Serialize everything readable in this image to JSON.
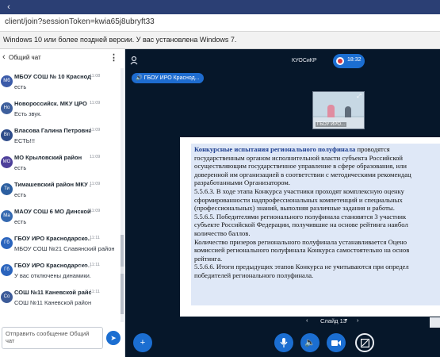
{
  "browser": {
    "url": "client/join?sessionToken=kwia65j8ubryft33",
    "info_message": "Windows 10 или более поздней версии. У вас установлена Windows 7."
  },
  "chat": {
    "title": "Общий чат",
    "messages": [
      {
        "initials": "Мб",
        "color": "#3b5ba9",
        "sender": "МБОУ СОШ № 10 Краснода...",
        "time": "11:08",
        "text": "есть"
      },
      {
        "initials": "Но",
        "color": "#3e5f9c",
        "sender": "Новороссийск. МКУ ЦРО",
        "time": "11:09",
        "text": "Есть звук."
      },
      {
        "initials": "Вп",
        "color": "#2f4d8a",
        "sender": "Власова Галина Петровна",
        "time": "11:09",
        "text": "ЕСТЬ!!!"
      },
      {
        "initials": "МО",
        "color": "#4d3f9a",
        "sender": "МО Крыловский район",
        "time": "11:09",
        "text": "есть"
      },
      {
        "initials": "Ти",
        "color": "#2c5fa0",
        "sender": "Тимашевский район МКУ ...",
        "time": "11:09",
        "text": "есть"
      },
      {
        "initials": "Ма",
        "color": "#3569b0",
        "sender": "МАОУ СОШ 6 МО Динской...",
        "time": "11:09",
        "text": "есть"
      },
      {
        "initials": "Гб",
        "color": "#2a64bd",
        "sender": "ГБОУ ИРО Краснодарско...",
        "time": "11:11",
        "text": "МБОУ СОШ №21 Славянский район"
      },
      {
        "initials": "Гб",
        "color": "#2a64bd",
        "sender": "ГБОУ ИРО Краснодарско...",
        "time": "11:11",
        "text": "У вас отключены динамики."
      },
      {
        "initials": "Со",
        "color": "#3d5b99",
        "sender": "СОШ №11 Каневской район",
        "time": "11:11",
        "text": "СОШ №11 Каневской район"
      }
    ],
    "input_placeholder": "Отправить сообщение Общий чат"
  },
  "main": {
    "conference_name": "КУОСиКР",
    "recording_time": "18:32",
    "presenter_label": "ГБОУ ИРО Краснод...",
    "video_label": "ГБОУ ИРО...",
    "slide": {
      "heading_bold": "Конкурсные испытания регионального полуфинала",
      "lines": [
        "государственным органом исполнительной власти субъекта Российской",
        "осуществляющим государственное управление в сфере образования, или",
        "доверенной им организацией в соответствии с методическими рекомендац",
        "разработанными Организатором.",
        "5.5.6.3. В ходе этапа Конкурса участники проходят комплексную оценку",
        "сформированности надпрофессиональных компетенций и специальных",
        "(профессиональных) знаний, выполняя различные задания и работы.",
        "5.5.6.5. Победителями регионального полуфинала становятся 3 участник",
        "субъекте Российской Федерации, получившие на основе рейтинга наибол",
        "количество баллов.",
        "Количество призеров регионального полуфинала устанавливается Оцено",
        "комиссией регионального полуфинала Конкурса самостоятельно на основ",
        "рейтинга.",
        "5.5.6.6. Итоги предыдущих этапов Конкурса не учитываются при определ",
        "победителей регионального полуфинала."
      ],
      "heading_tail": " проводятся"
    },
    "slide_nav_label": "Слайд 13"
  }
}
